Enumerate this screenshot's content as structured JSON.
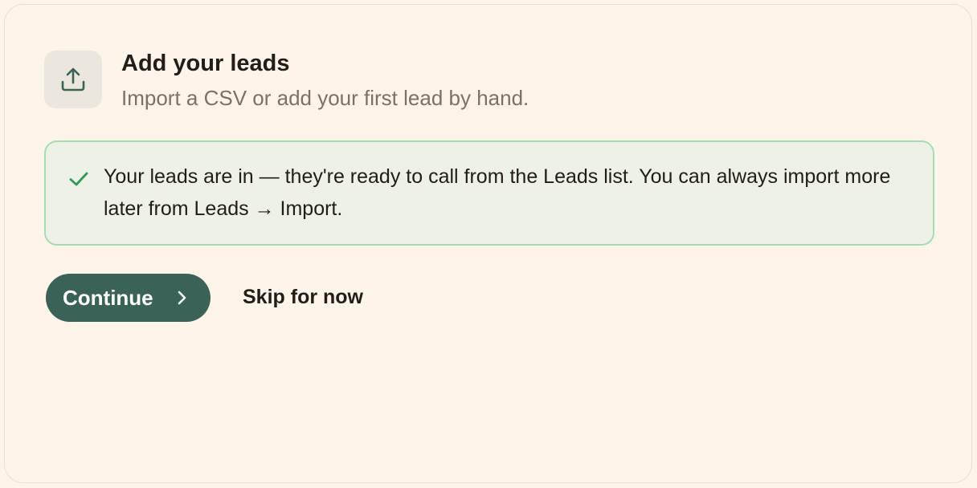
{
  "step": {
    "icon": "upload-icon",
    "title": "Add your leads",
    "subtitle": "Import a CSV or add your first lead by hand."
  },
  "notice": {
    "icon": "checkmark-icon",
    "text": "Your leads are in — they're ready to call from the Leads list. You can always import more later from Leads → Import."
  },
  "actions": {
    "continue_label": "Continue",
    "continue_icon": "chevron-right-icon",
    "skip_label": "Skip for now"
  },
  "colors": {
    "background": "#fdf5ea",
    "primary": "#3a6257",
    "success": "#2e9a56",
    "success_border": "#a7dcb3"
  }
}
